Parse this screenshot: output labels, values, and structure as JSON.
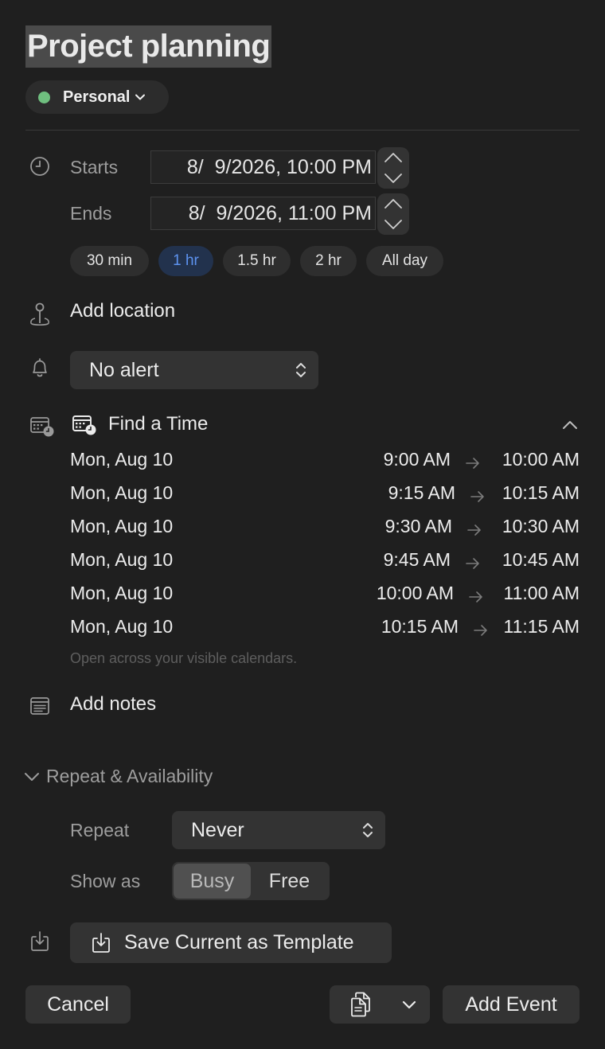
{
  "event": {
    "title": "Project planning"
  },
  "calendar": {
    "name": "Personal",
    "color": "#6fbf7f"
  },
  "time": {
    "starts_label": "Starts",
    "ends_label": "Ends",
    "start_value": "8/  9/2026, 10:00 PM",
    "end_value": "8/  9/2026, 11:00 PM"
  },
  "durations": [
    "30 min",
    "1 hr",
    "1.5 hr",
    "2 hr",
    "All day"
  ],
  "duration_selected": "1 hr",
  "location": {
    "placeholder": "Add location"
  },
  "alert": {
    "value": "No alert"
  },
  "find_time": {
    "title": "Find a Time",
    "slots": [
      {
        "date": "Mon, Aug 10",
        "start": "9:00 AM",
        "end": "10:00 AM"
      },
      {
        "date": "Mon, Aug 10",
        "start": "9:15 AM",
        "end": "10:15 AM"
      },
      {
        "date": "Mon, Aug 10",
        "start": "9:30 AM",
        "end": "10:30 AM"
      },
      {
        "date": "Mon, Aug 10",
        "start": "9:45 AM",
        "end": "10:45 AM"
      },
      {
        "date": "Mon, Aug 10",
        "start": "10:00 AM",
        "end": "11:00 AM"
      },
      {
        "date": "Mon, Aug 10",
        "start": "10:15 AM",
        "end": "11:15 AM"
      }
    ],
    "hint": "Open across your visible calendars."
  },
  "notes": {
    "placeholder": "Add notes"
  },
  "repeat_section": {
    "title": "Repeat & Availability",
    "repeat_label": "Repeat",
    "repeat_value": "Never",
    "show_as_label": "Show as",
    "show_as_options": [
      "Busy",
      "Free"
    ],
    "show_as_selected": "Busy"
  },
  "template": {
    "save_label": "Save Current as Template"
  },
  "footer": {
    "cancel_label": "Cancel",
    "add_label": "Add Event"
  },
  "icons": [
    "clock-icon",
    "pin-icon",
    "bell-icon",
    "calendar-clock-icon",
    "notes-icon",
    "download-icon",
    "copy-icon",
    "chevron-down-icon",
    "chevron-up-icon",
    "up-down-icon"
  ]
}
